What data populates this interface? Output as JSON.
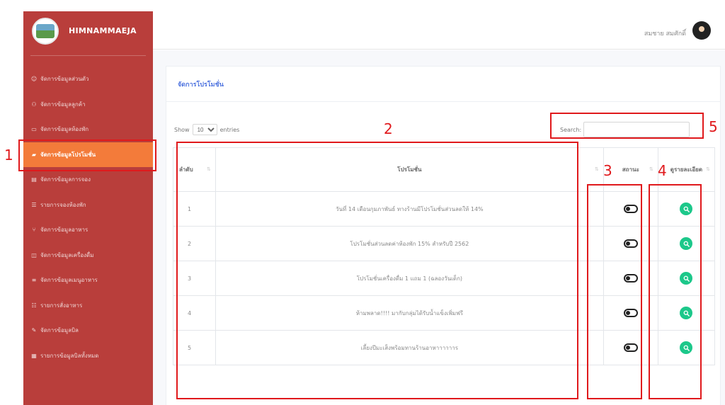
{
  "brand": {
    "name": "HIMNAMMAEJA"
  },
  "sidebar": {
    "items": [
      {
        "label": "จัดการข้อมูลส่วนตัว",
        "icon": "user-icon",
        "active": false
      },
      {
        "label": "จัดการข้อมูลลูกค้า",
        "icon": "users-icon",
        "active": false
      },
      {
        "label": "จัดการข้อมูลห้องพัก",
        "icon": "bed-icon",
        "active": false
      },
      {
        "label": "จัดการข้อมูลโปรโมชั่น",
        "icon": "tag-icon",
        "active": true
      },
      {
        "label": "จัดการข้อมูลการจอง",
        "icon": "book-icon",
        "active": false
      },
      {
        "label": "รายการจองห้องพัก",
        "icon": "list-icon",
        "active": false
      },
      {
        "label": "จัดการข้อมูลอาหาร",
        "icon": "utensils-icon",
        "active": false
      },
      {
        "label": "จัดการข้อมูลเครื่องดื่ม",
        "icon": "cup-icon",
        "active": false
      },
      {
        "label": "จัดการข้อมูลเมนูอาหาร",
        "icon": "menu-icon",
        "active": false
      },
      {
        "label": "รายการสั่งอาหาร",
        "icon": "order-icon",
        "active": false
      },
      {
        "label": "จัดการข้อมูลบิล",
        "icon": "pen-icon",
        "active": false
      },
      {
        "label": "รายการข้อมูลบิลทั้งหมด",
        "icon": "receipt-icon",
        "active": false
      }
    ]
  },
  "topbar": {
    "user_name": "สมชาย สมศักดิ์"
  },
  "card": {
    "title": "จัดการโปรโมชั่น"
  },
  "table_controls": {
    "show_label": "Show",
    "entries_value": "10",
    "entries_label": "entries",
    "search_label": "Search:",
    "search_value": ""
  },
  "table": {
    "headers": {
      "order": "ลำดับ",
      "promotion": "โปรโมชั่น",
      "status": "สถานะ",
      "detail": "ดูรายละเอียด"
    },
    "rows": [
      {
        "order": "1",
        "promotion": "วันที่ 14 เดือนกุมภาพันธ์ ทางร้านมีโปรโมชั่นส่วนลดให้ 14%"
      },
      {
        "order": "2",
        "promotion": "โปรโมชั่นส่วนลดค่าห้องพัก 15% สำหรับปี 2562"
      },
      {
        "order": "3",
        "promotion": "โปรโมชั่นเครื่องดื่ม 1 แถม 1 (ฉลองวันเด็ก)"
      },
      {
        "order": "4",
        "promotion": "ห้ามพลาด!!!! มากับกลุ่มได้รับน้ำแข็งเพิ่มฟรี"
      },
      {
        "order": "5",
        "promotion": "เลี้ยงปีมะเส็งพร้อมทานร้านอาหาาาาาาร"
      }
    ]
  },
  "annotations": [
    "1",
    "2",
    "3",
    "4",
    "5"
  ],
  "colors": {
    "sidebar": "#b93e3b",
    "active_item": "#f37b3a",
    "accent": "#4e73df",
    "detail_button": "#1cc88a",
    "annotation": "#e0191c"
  }
}
